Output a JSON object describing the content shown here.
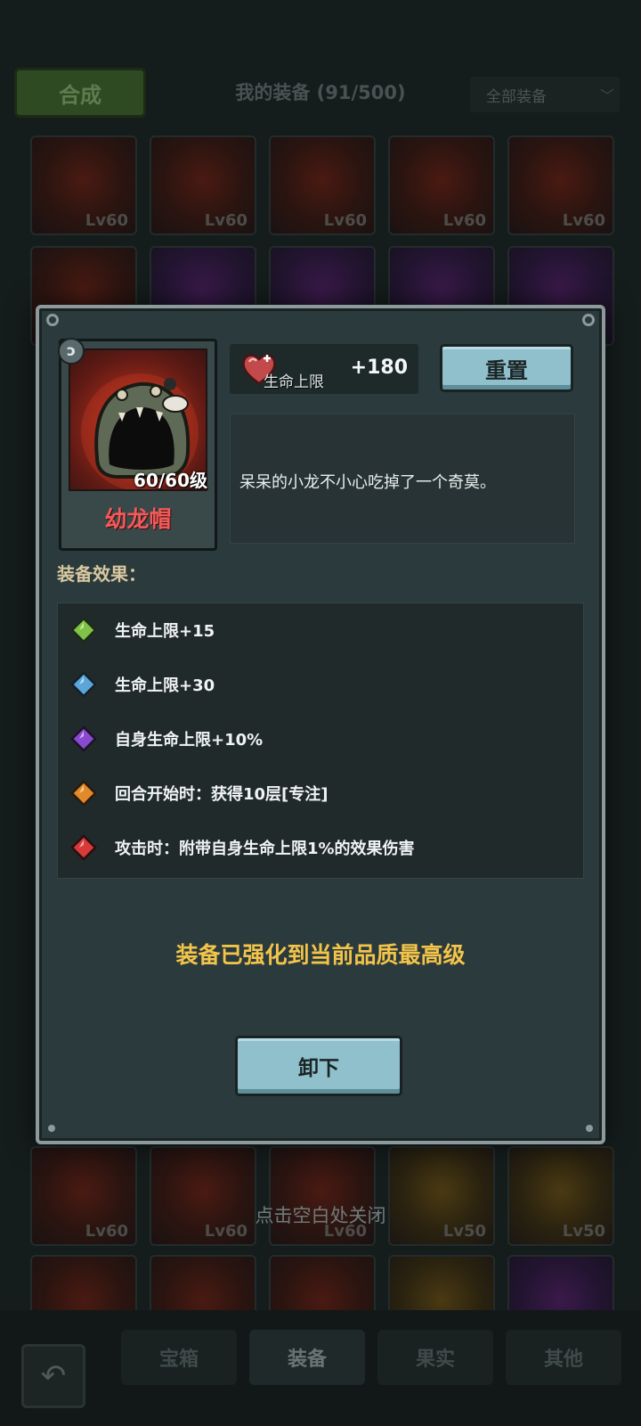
{
  "background": {
    "synth_label": "合成",
    "title": "我的装备 (91/500)",
    "filter_label": "全部装备",
    "row1_levels": [
      "Lv60",
      "Lv60",
      "Lv60",
      "Lv60",
      "Lv60"
    ],
    "row_bottom_levels": [
      "Lv60",
      "Lv60",
      "Lv60",
      "Lv50",
      "Lv50"
    ],
    "close_hint": "点击空白处关闭",
    "tabs": [
      {
        "label": "宝箱",
        "active": false
      },
      {
        "label": "装备",
        "active": true
      },
      {
        "label": "果实",
        "active": false
      },
      {
        "label": "其他",
        "active": false
      }
    ]
  },
  "item": {
    "name": "幼龙帽",
    "level": "60/60级",
    "type_badge_icon": "swirl-icon",
    "name_color": "#f05a5a"
  },
  "stat": {
    "icon": "heart-icon",
    "label": "生命上限",
    "value": "+180"
  },
  "buttons": {
    "reset": "重置",
    "unequip": "卸下"
  },
  "description": "呆呆的小龙不小心吃掉了一个奇莫。",
  "effects": {
    "title": "装备效果：",
    "items": [
      {
        "gem": "green-gem-icon",
        "color": "#7ec24a",
        "text": "生命上限+15"
      },
      {
        "gem": "blue-gem-icon",
        "color": "#5aa6d8",
        "text": "生命上限+30"
      },
      {
        "gem": "purple-gem-icon",
        "color": "#8a4ad0",
        "text": "自身生命上限+10%"
      },
      {
        "gem": "orange-gem-icon",
        "color": "#e08a2a",
        "text": "回合开始时：获得10层[专注]"
      },
      {
        "gem": "red-gem-icon",
        "color": "#d83a3a",
        "text": "攻击时：附带自身生命上限1%的效果伤害"
      }
    ]
  },
  "max_note": "装备已强化到当前品质最高级"
}
